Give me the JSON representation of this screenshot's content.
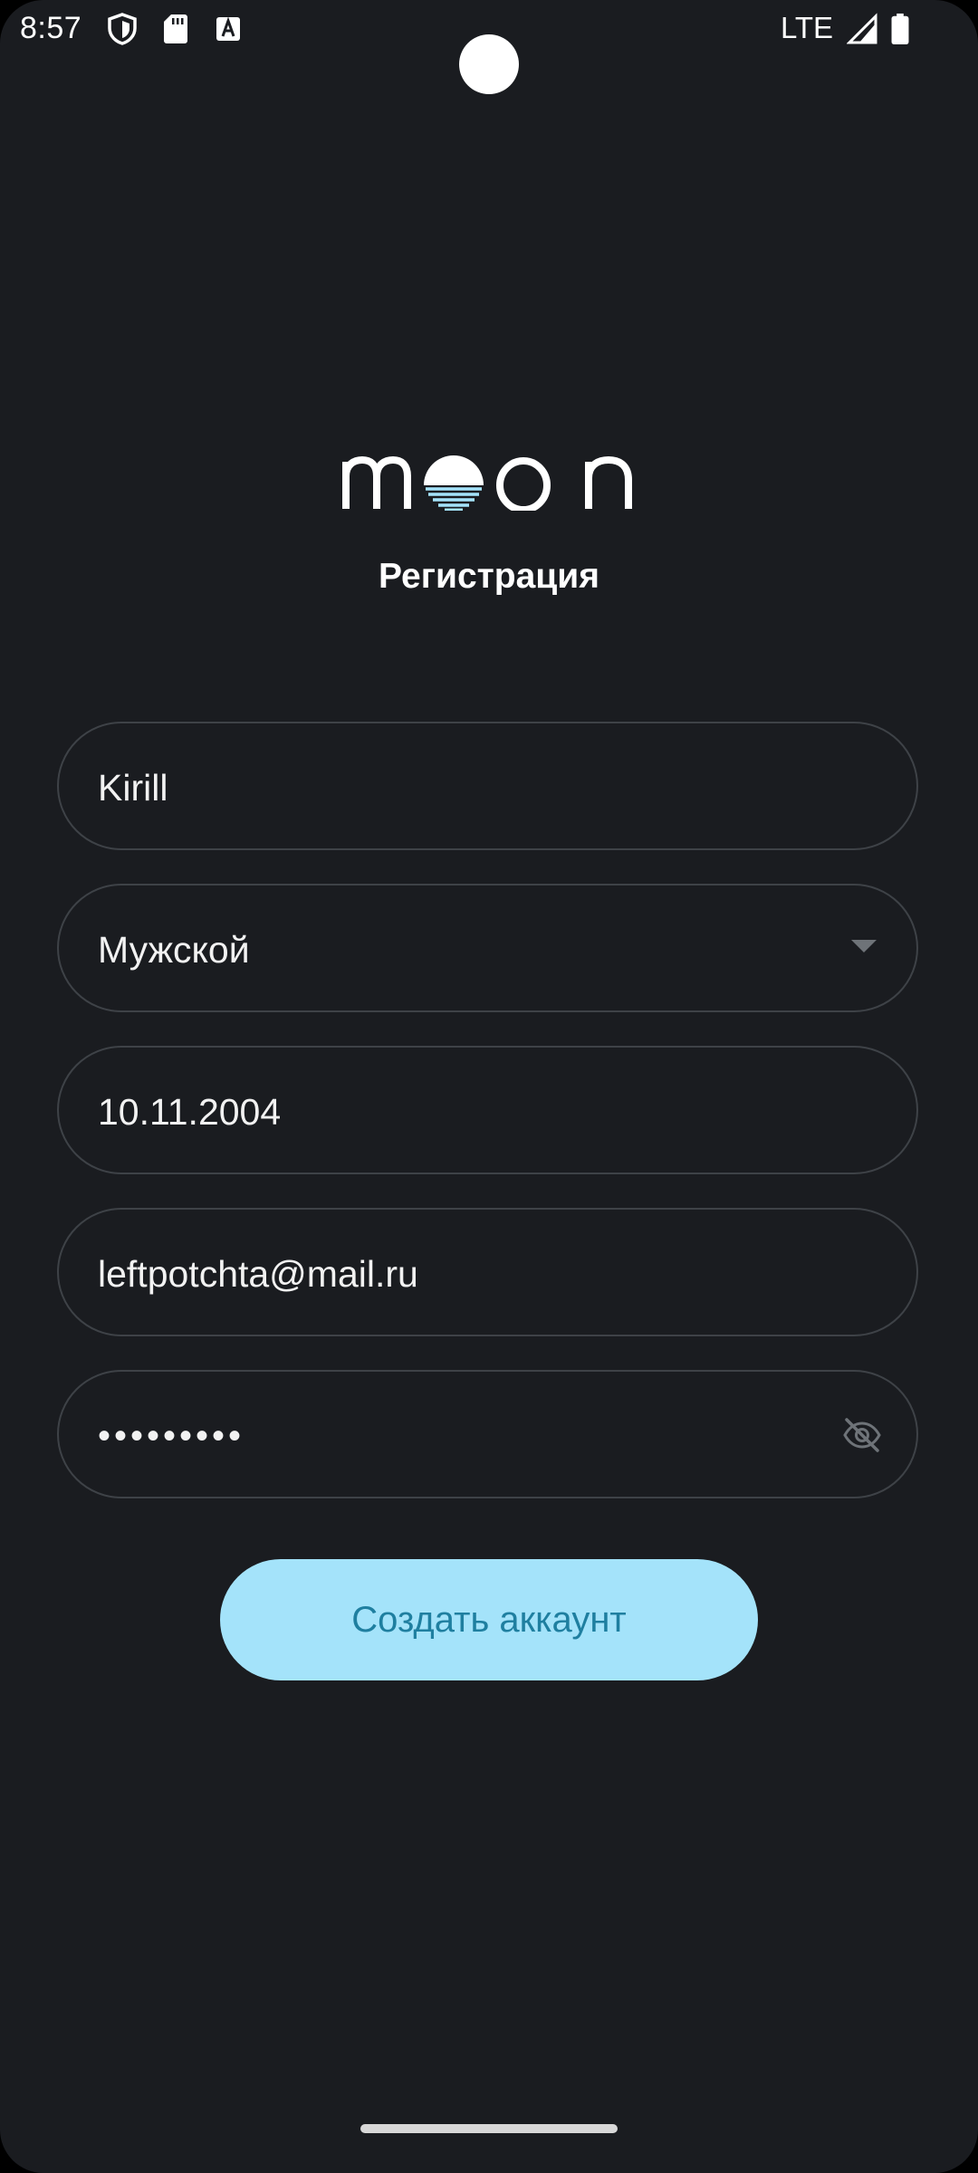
{
  "status_bar": {
    "time": "8:57",
    "network": "LTE",
    "icons": [
      "shield-icon",
      "sd-card-icon",
      "font-icon",
      "signal-icon",
      "battery-icon"
    ]
  },
  "logo": {
    "text": "moon",
    "accent_color": "#a4e3fa"
  },
  "screen": {
    "title": "Регистрация"
  },
  "form": {
    "name": {
      "value": "Kirill"
    },
    "gender": {
      "value": "Мужской",
      "icon": "dropdown-arrow-icon"
    },
    "birth_date": {
      "value": "10.11.2004"
    },
    "email": {
      "value": "leftpotchta@mail.ru"
    },
    "password": {
      "value": "•••••••••",
      "icon": "eye-off-icon"
    }
  },
  "submit_button": {
    "label": "Создать аккаунт"
  },
  "colors": {
    "background": "#1a1c20",
    "field_border": "#3e4247",
    "button_bg": "#a4e3fa",
    "button_text": "#1f7fa0"
  }
}
